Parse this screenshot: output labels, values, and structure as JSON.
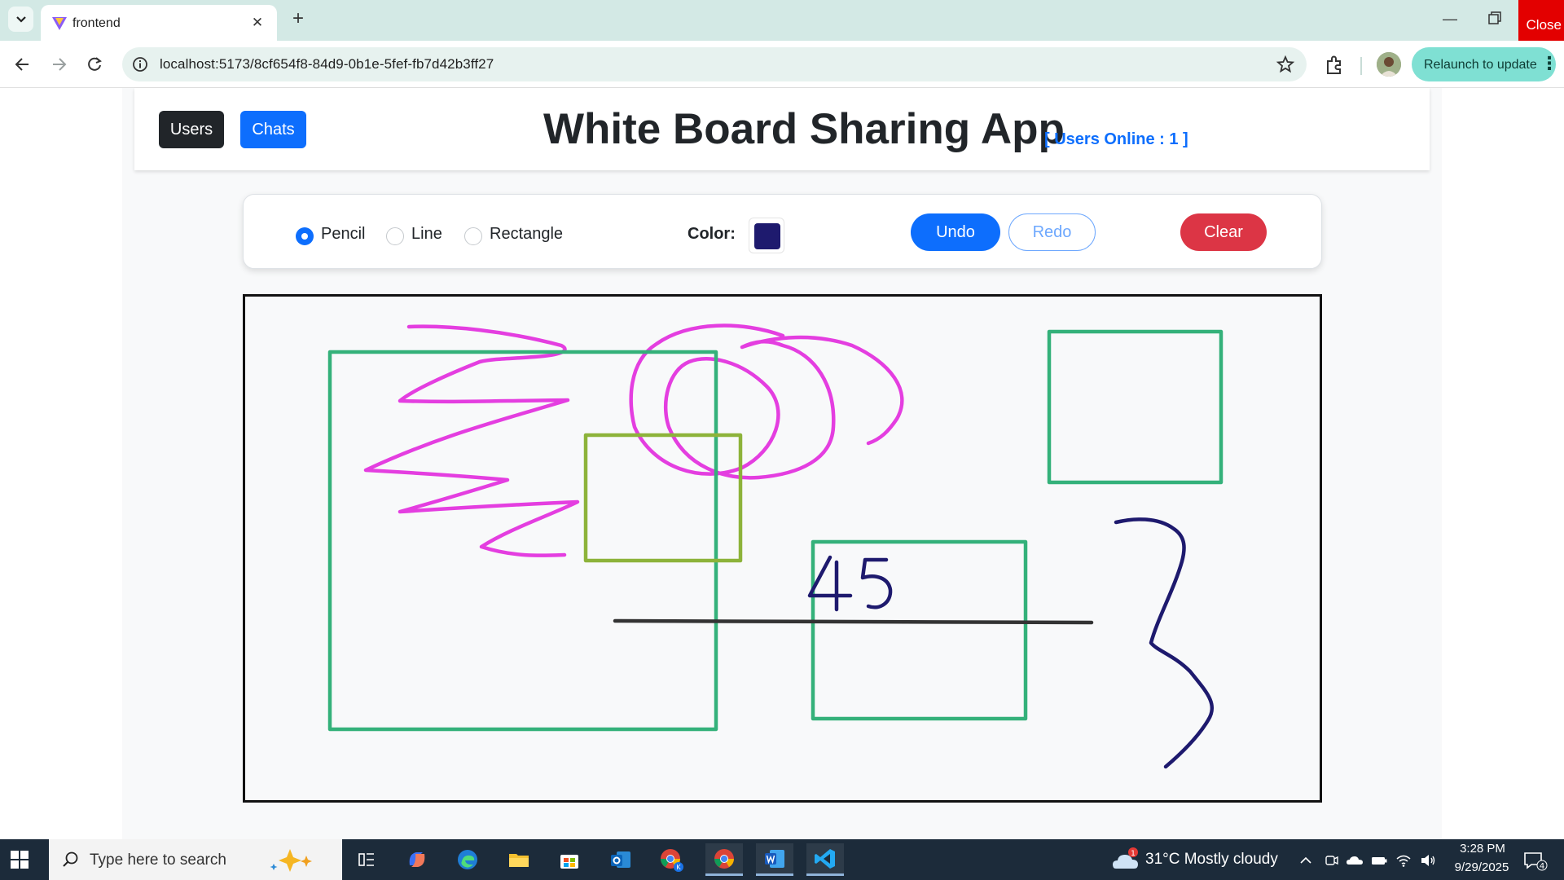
{
  "browser": {
    "tab_title": "frontend",
    "url": "localhost:5173/8cf654f8-84d9-0b1e-5fef-fb7d42b3ff27",
    "relaunch_label": "Relaunch to update",
    "close_label": "Close",
    "new_tab": "+",
    "tab_close": "✕",
    "minimize": "—"
  },
  "header": {
    "users_label": "Users",
    "chats_label": "Chats",
    "title": "White Board Sharing App",
    "online": "[ Users Online : 1 ]"
  },
  "tools": {
    "options": [
      {
        "label": "Pencil",
        "checked": true
      },
      {
        "label": "Line",
        "checked": false
      },
      {
        "label": "Rectangle",
        "checked": false
      }
    ],
    "color_label": "Color:",
    "color_value": "#1e1a6e",
    "undo_label": "Undo",
    "redo_label": "Redo",
    "clear_label": "Clear"
  },
  "board": {
    "text_drawn": "45",
    "stroke_colors": {
      "pink": "#e43ee0",
      "green": "#34b17a",
      "olive": "#8db33a",
      "navy": "#1e1a6e",
      "black": "#333333"
    }
  },
  "taskbar": {
    "search_placeholder": "Type here to search",
    "weather": "31°C  Mostly cloudy",
    "weather_badge": "1",
    "time": "3:28 PM",
    "date": "9/29/2025",
    "notification_count": "4",
    "apps": [
      "task-view",
      "copilot",
      "edge",
      "file-explorer",
      "microsoft-store",
      "outlook",
      "chrome-profile",
      "chrome",
      "word",
      "vscode"
    ]
  }
}
